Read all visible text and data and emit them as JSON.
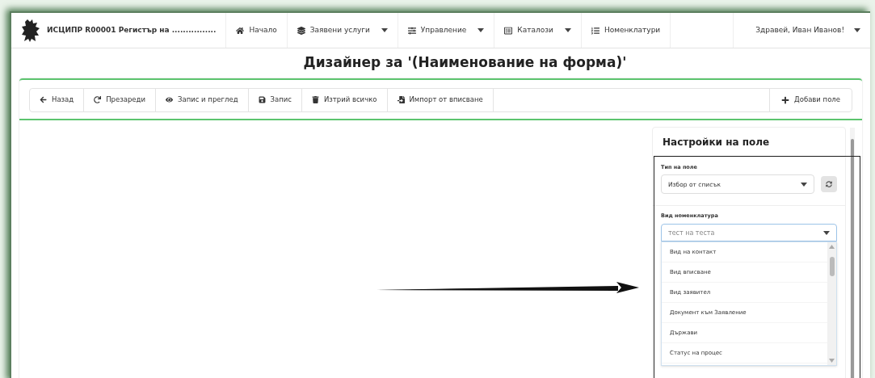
{
  "navbar": {
    "brand": "ИСЦИПР R00001 Регистър на ................",
    "items": [
      {
        "label": "Начало",
        "dropdown": false
      },
      {
        "label": "Заявени услуги",
        "dropdown": true
      },
      {
        "label": "Управление",
        "dropdown": true
      },
      {
        "label": "Каталози",
        "dropdown": true
      },
      {
        "label": "Номенклатури",
        "dropdown": false
      }
    ],
    "user": {
      "label": "Здравей, Иван Иванов!",
      "dropdown": true
    }
  },
  "page_title": "Дизайнер за '(Наименование на форма)'",
  "toolbar": {
    "buttons": [
      {
        "label": "Назад"
      },
      {
        "label": "Презареди"
      },
      {
        "label": "Запис и преглед"
      },
      {
        "label": "Запис"
      },
      {
        "label": "Изтрий всичко"
      },
      {
        "label": "Импорт от вписване"
      }
    ],
    "right_button": {
      "label": "Добави поле"
    }
  },
  "field_settings": {
    "title": "Настройки на поле",
    "field_type": {
      "label": "Тип на поле",
      "value": "Избор от списък"
    },
    "nomenclature": {
      "label": "Вид номенклатура",
      "placeholder": "тест на теста",
      "expanded": true,
      "options": [
        "Вид на контакт",
        "Вид вписване",
        "Вид заявител",
        "Документ към Заявление",
        "Държави",
        "Статус на процес"
      ]
    }
  }
}
